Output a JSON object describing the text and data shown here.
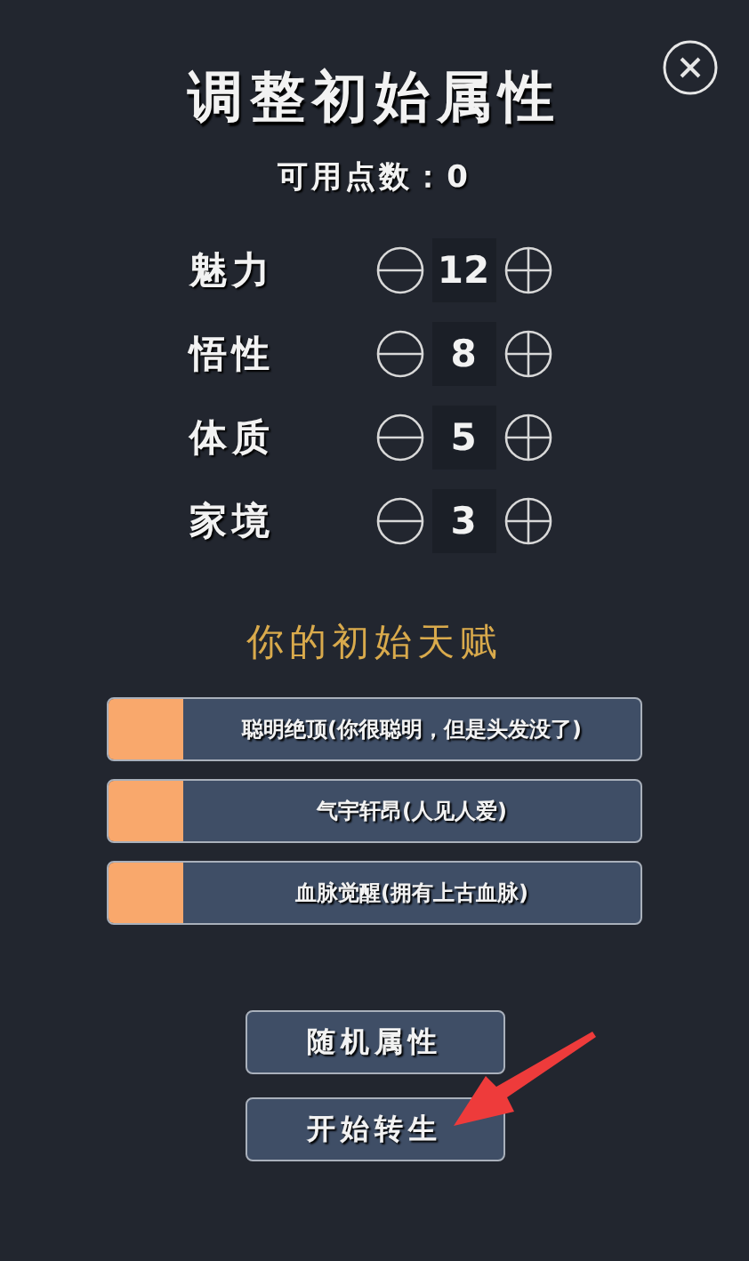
{
  "title": "调整初始属性",
  "points": "可用点数：0",
  "attributes": [
    {
      "name": "魅力",
      "value": "12"
    },
    {
      "name": "悟性",
      "value": "8"
    },
    {
      "name": "体质",
      "value": "5"
    },
    {
      "name": "家境",
      "value": "3"
    }
  ],
  "talents_heading": "你的初始天赋",
  "talents": [
    {
      "label": "聪明绝顶(你很聪明，但是头发没了)"
    },
    {
      "label": "气宇轩昂(人见人爱)"
    },
    {
      "label": "血脉觉醒(拥有上古血脉)"
    }
  ],
  "buttons": [
    "随机属性",
    "开始转生"
  ]
}
